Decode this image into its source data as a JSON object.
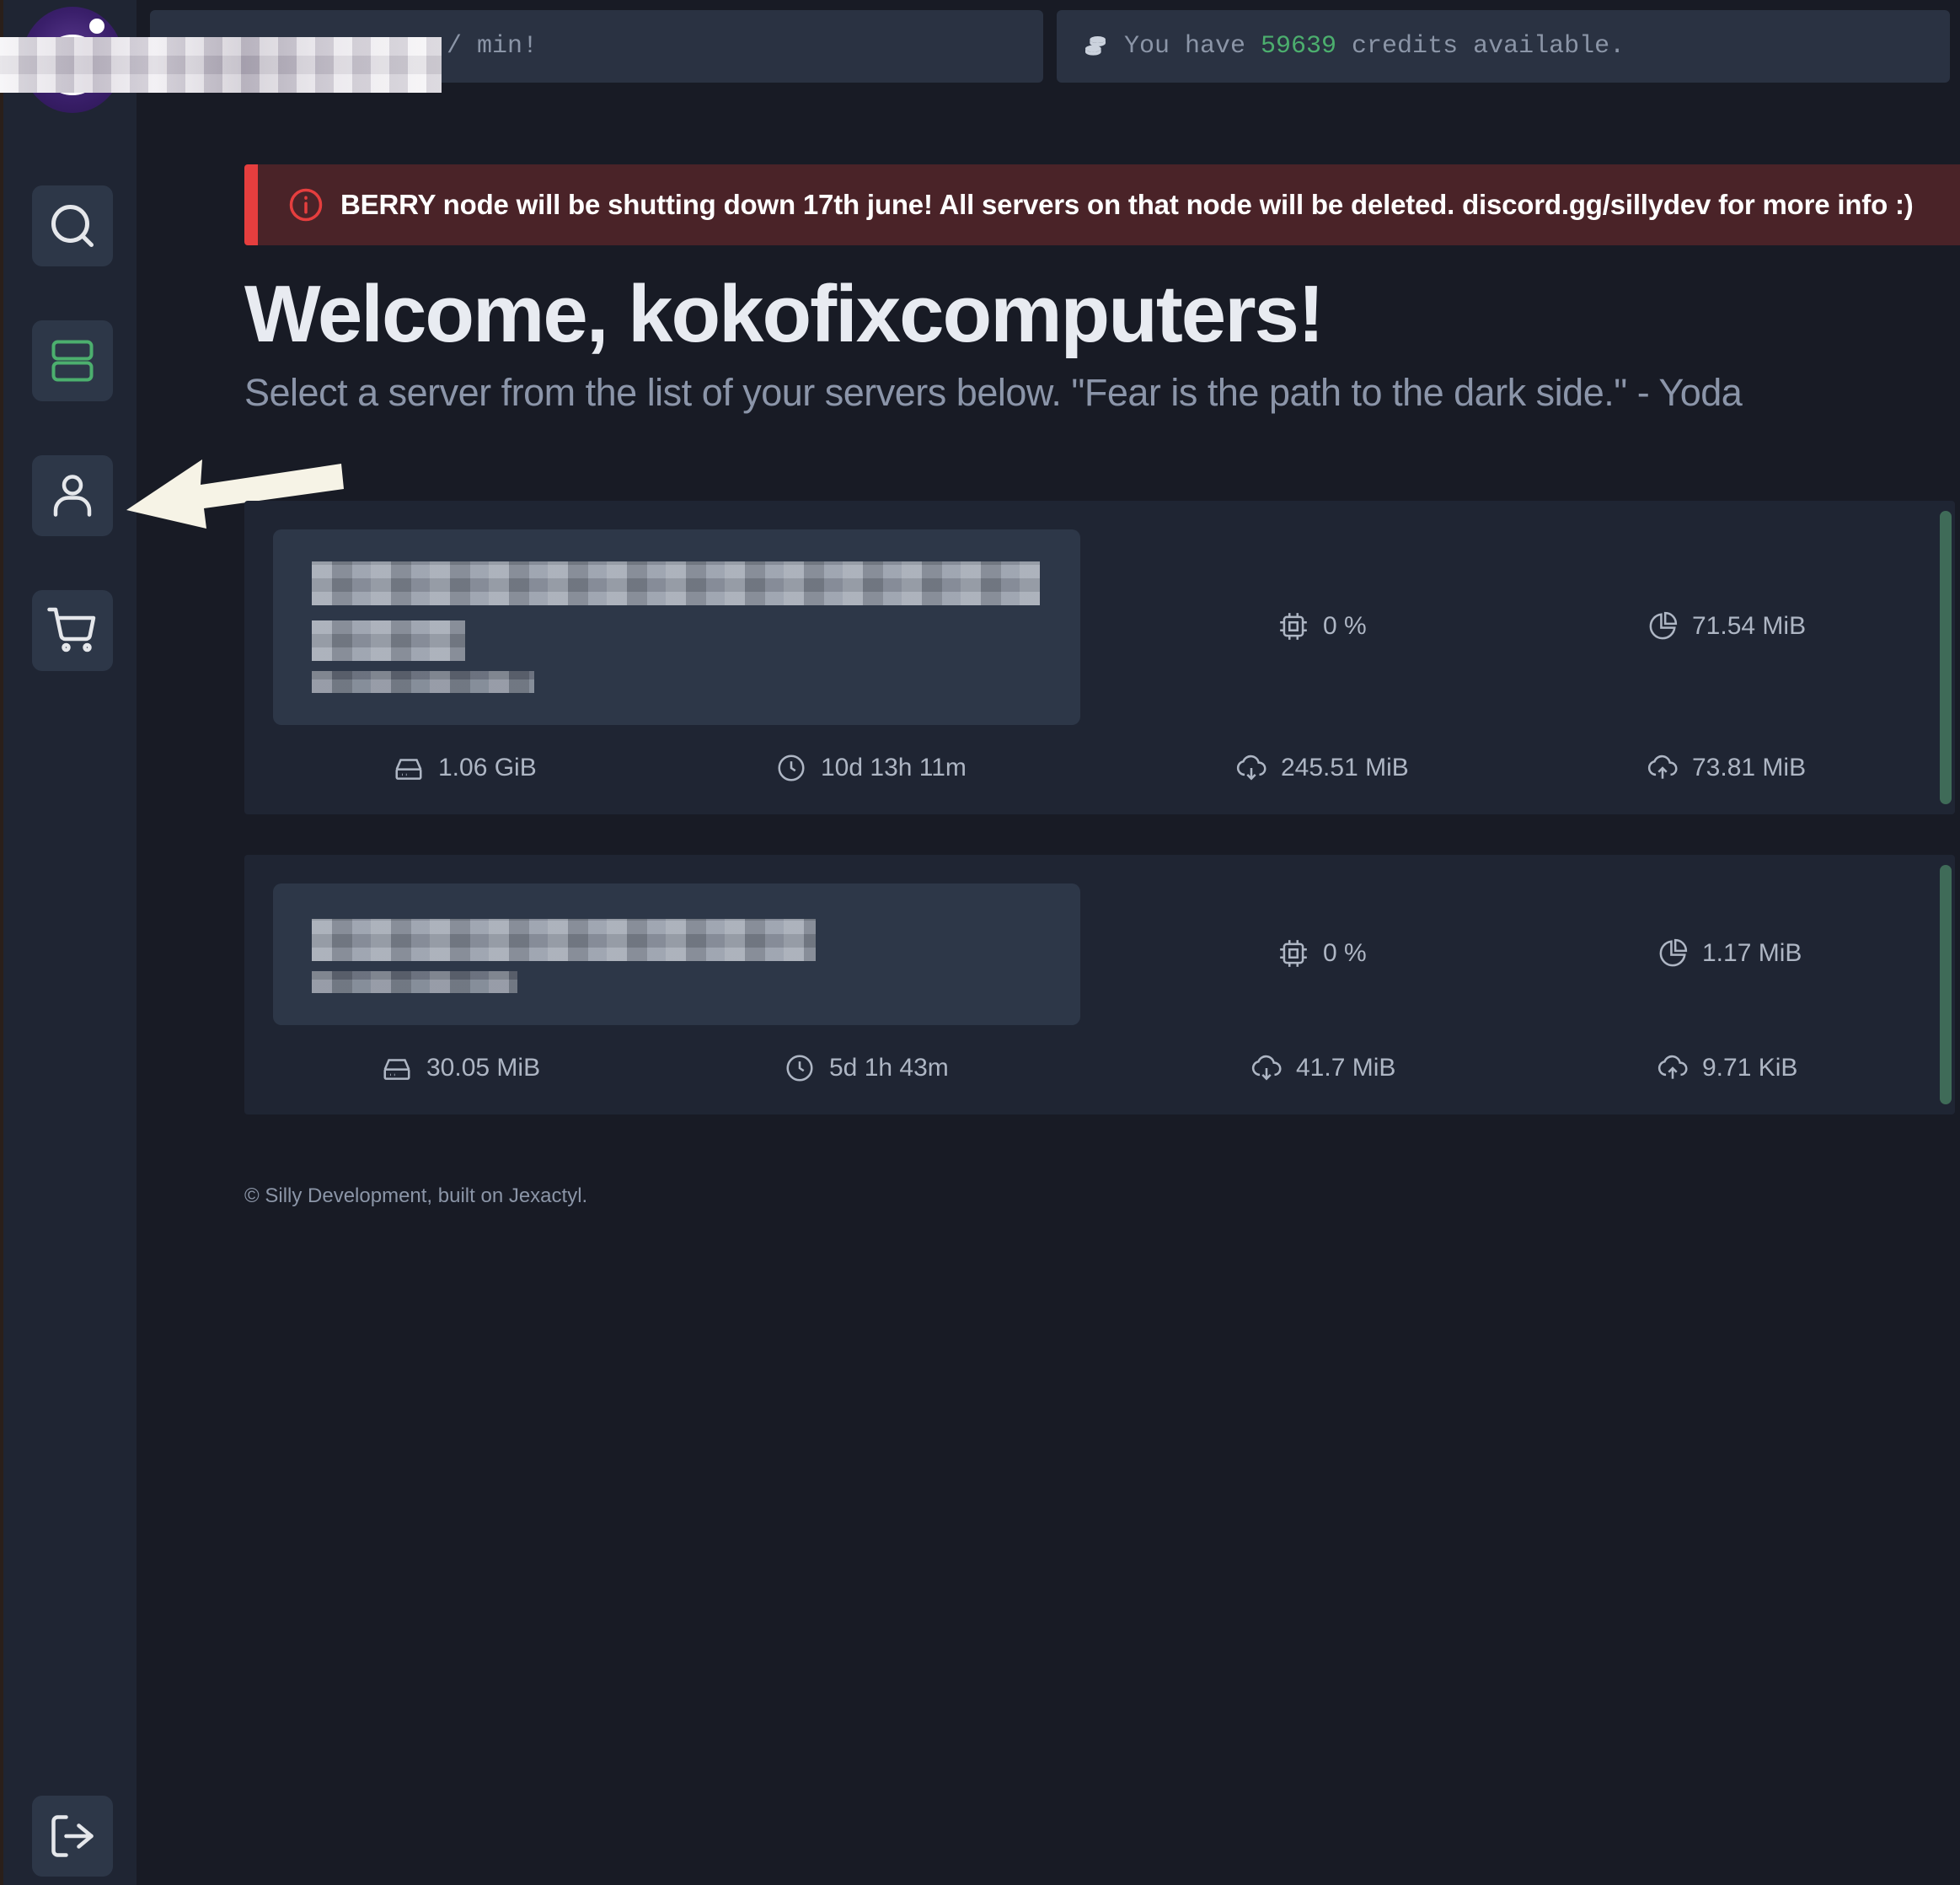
{
  "topbar": {
    "rate_text": "s / min!",
    "credits_prefix": "You have ",
    "credits_value": "59639",
    "credits_suffix": " credits available."
  },
  "sidebar": {
    "items": [
      {
        "name": "search",
        "icon": "search-icon"
      },
      {
        "name": "servers",
        "icon": "server-icon",
        "active": true
      },
      {
        "name": "account",
        "icon": "user-icon"
      },
      {
        "name": "store",
        "icon": "cart-icon"
      },
      {
        "name": "logout",
        "icon": "logout-icon"
      }
    ]
  },
  "alert": {
    "text": "BERRY node will be shutting down 17th june! All servers on that node will be deleted. discord.gg/sillydev for more info :)",
    "color": "#e53e3e"
  },
  "welcome": {
    "title": "Welcome, kokofixcomputers!",
    "subtitle": "Select a server from the list of your servers below. \"Fear is the path to the dark side.\" - Yoda"
  },
  "servers": [
    {
      "cpu": "0 %",
      "memory": "71.54 MiB",
      "disk": "1.06 GiB",
      "uptime": "10d 13h 11m",
      "network_in": "245.51 MiB",
      "network_out": "73.81 MiB"
    },
    {
      "cpu": "0 %",
      "memory": "1.17 MiB",
      "disk": "30.05 MiB",
      "uptime": "5d 1h 43m",
      "network_in": "41.7 MiB",
      "network_out": "9.71 KiB"
    }
  ],
  "footer": {
    "text": "© Silly Development, built on Jexactyl."
  },
  "colors": {
    "accent_green": "#4caf6e",
    "status_bar": "#3f6b58",
    "background": "#181b25"
  }
}
